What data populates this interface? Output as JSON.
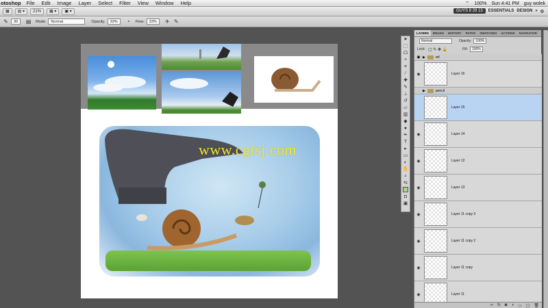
{
  "menubar": {
    "app_name": "otoshop",
    "items": [
      "File",
      "Edit",
      "Image",
      "Layer",
      "Select",
      "Filter",
      "View",
      "Window",
      "Help"
    ],
    "battery": "100%",
    "clock": "Sun 4:41 PM",
    "user": "guy wolek"
  },
  "appbar": {
    "zoom": "21%",
    "badge": "GUYS 8 29 13",
    "workspace1": "ESSENTIALS",
    "workspace2": "DESIGN",
    "more": "»"
  },
  "options": {
    "mode_label": "Mode:",
    "mode_value": "Normal",
    "opacity_label": "Opacity:",
    "opacity_value": "33%",
    "flow_label": "Flow:",
    "flow_value": "33%",
    "brush_size": "30"
  },
  "watermark": "www.cgtsj.com",
  "panel": {
    "tabs": [
      "LAYERS",
      "BRUSH",
      "HISTORY",
      "PATHS",
      "SWATCHES",
      "ACTIONS",
      "NAVIGATOR"
    ],
    "blend": "Normal",
    "opacity_label": "Opacity:",
    "opacity_value": "100%",
    "lock_label": "Lock:",
    "fill_label": "Fill:",
    "fill_value": "100%",
    "group_ref": "ref",
    "group_pencil": "pencil",
    "layers": [
      "Layer 16",
      "Layer 15",
      "Layer 14",
      "Layer 12",
      "Layer 13",
      "Layer 11 copy 3",
      "Layer 11 copy 2",
      "Layer 11 copy",
      "Layer 11"
    ],
    "footer_icons": [
      "link-icon",
      "fx-icon",
      "mask-icon",
      "adjust-icon",
      "folder-icon",
      "new-icon",
      "trash-icon"
    ]
  },
  "colors": {
    "selected_layer": "#b9d4f3",
    "watermark": "#f2e82a",
    "workspace_bg": "#535353"
  }
}
